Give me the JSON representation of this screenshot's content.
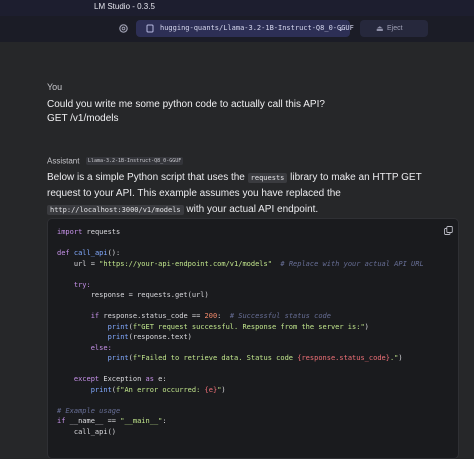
{
  "app": {
    "title": "LM Studio - 0.3.5"
  },
  "toolbar": {
    "model_name": "hugging-quants/Llama-3.2-1B-Instruct-Q8_0-GGUF",
    "eject_label": "Eject"
  },
  "user": {
    "label": "You",
    "line1": "Could you write me some python code to actually call this API?",
    "line2": "GET  /v1/models"
  },
  "assistant": {
    "label": "Assistant",
    "model_tag": "Llama-3.2-1B-Instruct-Q8_0-GGUF",
    "p_text1": "Below is a simple Python script that uses the",
    "p_code1": "requests",
    "p_text2": " library to make an HTTP GET request to your API. This example assumes you have replaced the",
    "p_code2": "http://localhost:3000/v1/models",
    "p_text3": " with your actual API endpoint."
  },
  "code": {
    "import_kw": "import",
    "import_mod": "requests",
    "def_kw": "def",
    "func_name": "call_api",
    "def_rest": "():",
    "url_lhs": "url = ",
    "url_val": "\"https://your-api-endpoint.com/v1/models\"",
    "url_cmt": "# Replace with your actual API URL",
    "try_kw": "try:",
    "resp_line": "response = requests.get(url)",
    "if_kw": "if",
    "if_cond": " response.status_code == ",
    "if_num": "200",
    "if_colon": ":",
    "if_cmt": "# Successful status code",
    "print_fn": "print",
    "p1_str": "f\"GET request successful. Response from the server is:\"",
    "p2_args": "(response.text)",
    "else_kw": "else:",
    "p3_str_a": "f\"Failed to retrieve data. Status code ",
    "p3_ph": "{response.status_code}",
    "p3_str_b": ".\"",
    "except_kw": "except",
    "exc_name": " Exception ",
    "as_kw": "as",
    "exc_var": " e:",
    "p4_str_a": "f\"An error occurred: ",
    "p4_ph": "{e}",
    "p4_str_b": "\"",
    "usage_cmt": "# Example usage",
    "main_if_kw": "if",
    "main_cond": " __name__ == ",
    "main_str": "\"__main__\"",
    "main_colon": ":",
    "main_call": "call_api()"
  }
}
